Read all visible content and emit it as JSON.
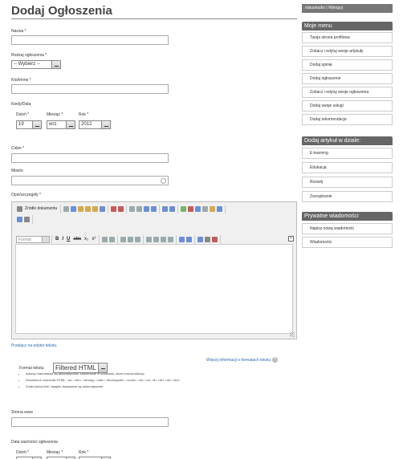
{
  "page": {
    "title": "Dodaj Ogłoszenia"
  },
  "form": {
    "name_label": "Nazwa *",
    "type_label": "Rodzaj ogłoszenia *",
    "type_value": "-- Wybierz --",
    "who_label": "Kto/Imme *",
    "when_label": "Kiedy/Data",
    "day_label": "Dzień *",
    "month_label": "Miesiąc *",
    "year_label": "Rok *",
    "day_value": "19",
    "month_value": "wrz.",
    "year_value": "2012",
    "price_label": "Cidze *",
    "city_label": "Miasto",
    "desc_label": "Opis/szczegóły *",
    "switch_editor": "Przełącz na edytor tekstu.",
    "more_info": "Więcej informacji o formatach tekstu",
    "format_label": "Format tekstu",
    "format_value": "Filtered HTML",
    "tips": [
      "Adresy internetowe są automatycznie zamieniane w odnośniki, które można kliknąć.",
      "Dozwolone znaczniki HTML: <a> <em> <strong> <cite> <blockquote> <code> <ul> <ol> <li> <dl> <dt> <dd>",
      "Znaki końca linii i akapitu dodawane są automatycznie."
    ],
    "www_label": "Strona www",
    "expiry_label": "Data ważności ogłoszenia",
    "day2_label": "Dzień *",
    "month2_label": "Miesiąc *",
    "year2_label": "Rok *"
  },
  "editor": {
    "source_label": "Źródło dokumentu",
    "format_placeholder": "Format",
    "bold": "B",
    "italic": "I",
    "underline": "U",
    "strike": "abc",
    "sub": "x₂",
    "sup": "x²",
    "collapse": "▪"
  },
  "sidebar": {
    "user_bar": "roburstudio | Wyloguj",
    "menu_title": "Moje menu",
    "menu_items": [
      "Twoja strona profilowa",
      "Zobacz i edytuj swoje artykuły",
      "Dodaj opinię",
      "Dodaj ogłoszenie",
      "Zobacz i edytuj swoje ogłoszenia",
      "Dodaj swoje usługi",
      "Dodaj rekomendacje"
    ],
    "articles_title": "Dodaj artykuł w dziale:",
    "article_items": [
      "E-learning",
      "Edukacja",
      "Rozwój",
      "Zarządzanie"
    ],
    "messages_title": "Prywatne wiadomości",
    "message_items": [
      "Napisz nową wiadomość",
      "Wiadomości"
    ]
  }
}
